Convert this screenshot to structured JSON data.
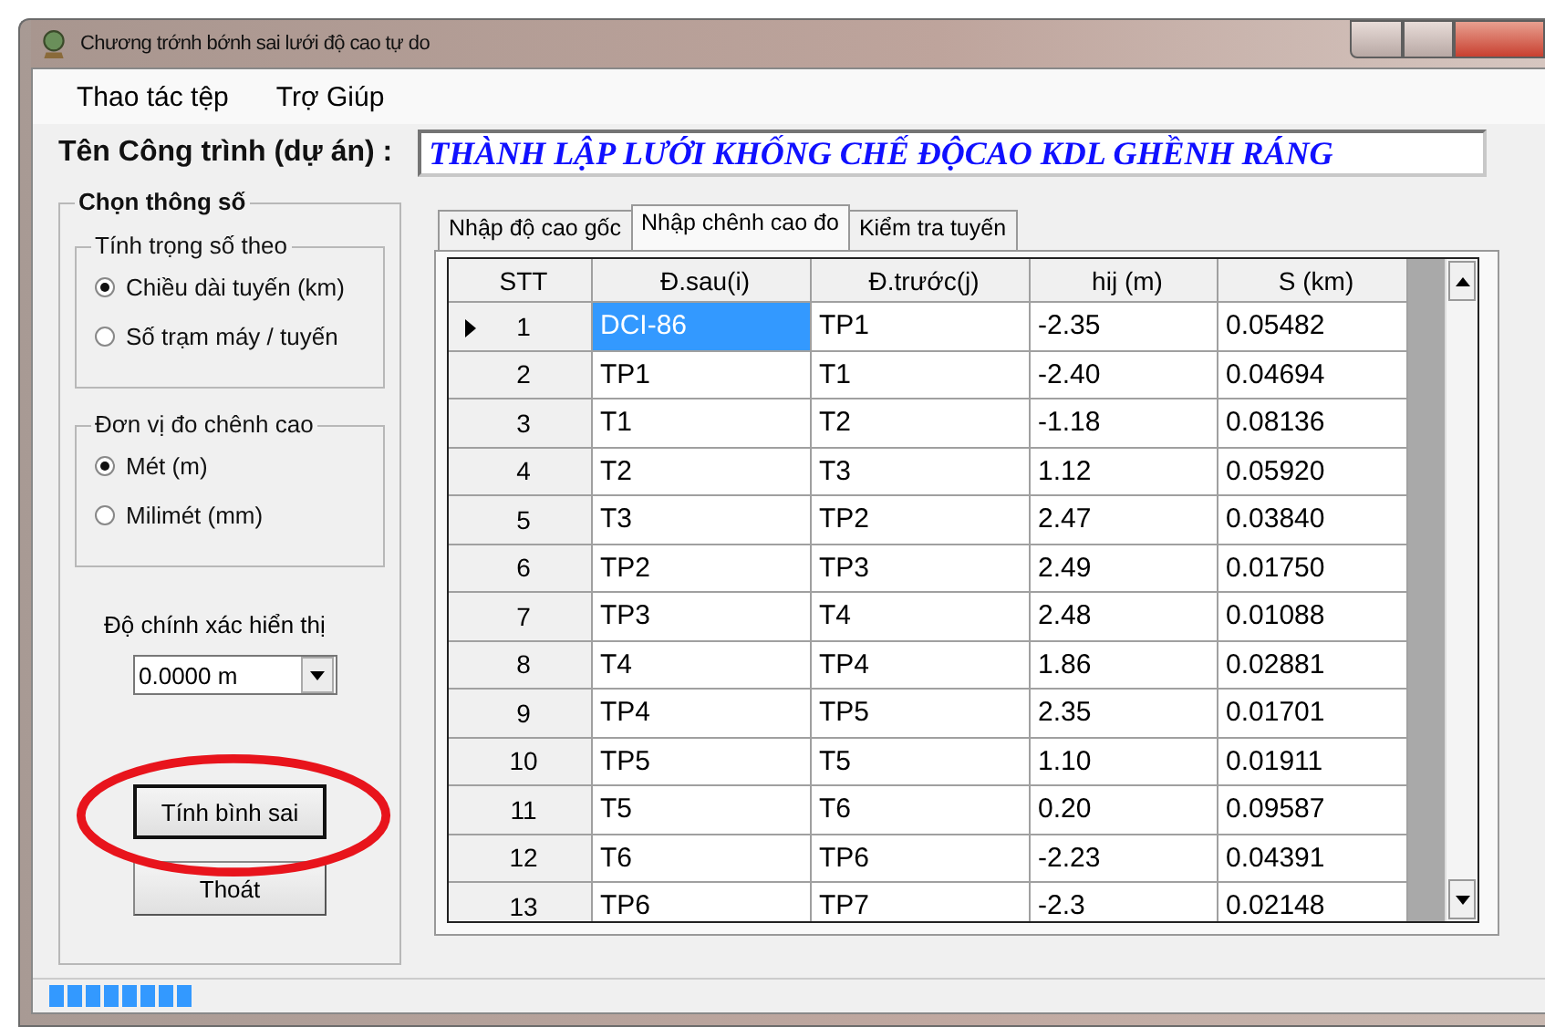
{
  "window": {
    "title": "Chương trớnh bớnh sai lưới độ cao tự do"
  },
  "menu": [
    "Thao tác tệp",
    "Trợ Giúp"
  ],
  "project": {
    "label": "Tên Công trình (dự án) :",
    "value": "THÀNH LẬP LƯỚI KHỐNG CHẾ ĐỘCAO KDL GHỀNH RÁNG"
  },
  "settings": {
    "title": "Chọn thông số",
    "groups": [
      {
        "title": "Tính trọng số theo",
        "options": [
          {
            "label": "Chiều dài tuyến (km)",
            "selected": true
          },
          {
            "label": "Số trạm máy / tuyến",
            "selected": false
          }
        ]
      },
      {
        "title": "Đơn vị đo chênh cao",
        "options": [
          {
            "label": "Mét (m)",
            "selected": true
          },
          {
            "label": "Milimét (mm)",
            "selected": false
          }
        ]
      }
    ],
    "precision_label": "Độ chính xác hiển thị",
    "precision_value": "0.0000 m",
    "buttons": [
      "Tính bình sai",
      "Thoát"
    ]
  },
  "tabs": [
    {
      "label": "Nhập độ cao gốc",
      "selected": false
    },
    {
      "label": "Nhập chênh cao đo",
      "selected": true
    },
    {
      "label": "Kiểm tra tuyến",
      "selected": false
    }
  ],
  "table": {
    "columns": [
      "STT",
      "Đ.sau(i)",
      "Đ.trước(j)",
      "hij (m)",
      "S (km)"
    ],
    "rows": [
      {
        "cells": [
          "1",
          "DCI-86",
          "TP1",
          "-2.35",
          "0.05482"
        ],
        "selected": true
      },
      {
        "cells": [
          "2",
          "TP1",
          "T1",
          "-2.40",
          "0.04694"
        ],
        "selected": false
      },
      {
        "cells": [
          "3",
          "T1",
          "T2",
          "-1.18",
          "0.08136"
        ],
        "selected": false
      },
      {
        "cells": [
          "4",
          "T2",
          "T3",
          "1.12",
          "0.05920"
        ],
        "selected": false
      },
      {
        "cells": [
          "5",
          "T3",
          "TP2",
          "2.47",
          "0.03840"
        ],
        "selected": false
      },
      {
        "cells": [
          "6",
          "TP2",
          "TP3",
          "2.49",
          "0.01750"
        ],
        "selected": false
      },
      {
        "cells": [
          "7",
          "TP3",
          "T4",
          "2.48",
          "0.01088"
        ],
        "selected": false
      },
      {
        "cells": [
          "8",
          "T4",
          "TP4",
          "1.86",
          "0.02881"
        ],
        "selected": false
      },
      {
        "cells": [
          "9",
          "TP4",
          "TP5",
          "2.35",
          "0.01701"
        ],
        "selected": false
      },
      {
        "cells": [
          "10",
          "TP5",
          "T5",
          "1.10",
          "0.01911"
        ],
        "selected": false
      },
      {
        "cells": [
          "11",
          "T5",
          "T6",
          "0.20",
          "0.09587"
        ],
        "selected": false
      },
      {
        "cells": [
          "12",
          "T6",
          "TP6",
          "-2.23",
          "0.04391"
        ],
        "selected": false
      },
      {
        "cells": [
          "13",
          "TP6",
          "TP7",
          "-2.3",
          "0.02148"
        ],
        "selected": false
      }
    ]
  }
}
